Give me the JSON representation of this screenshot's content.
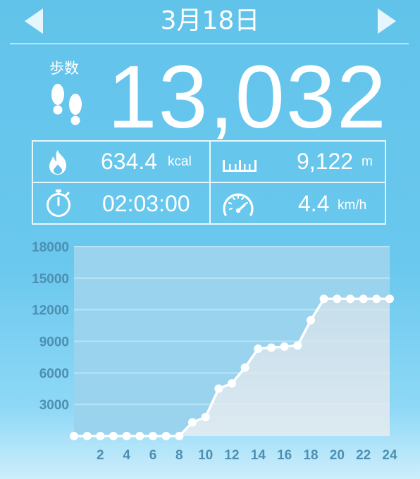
{
  "header": {
    "date": "3月18日",
    "prev_icon": "triangle-left",
    "next_icon": "triangle-right"
  },
  "steps": {
    "label": "歩数",
    "value": "13,032",
    "icon": "footprints"
  },
  "stats": {
    "calories": {
      "value": "634.4",
      "unit": "kcal",
      "icon": "flame"
    },
    "distance": {
      "value": "9,122",
      "unit": "m",
      "icon": "ruler"
    },
    "duration": {
      "value": "02:03:00",
      "unit": "",
      "icon": "stopwatch"
    },
    "speed": {
      "value": "4.4",
      "unit": "km/h",
      "icon": "speedometer"
    }
  },
  "colors": {
    "background": "#62c3ea",
    "line": "#ffffff",
    "plot_area": "#9ad3ee",
    "tick_label": "#4d8fb2"
  },
  "chart_data": {
    "type": "line",
    "x": [
      0,
      1,
      2,
      3,
      4,
      5,
      6,
      7,
      8,
      9,
      10,
      11,
      12,
      13,
      14,
      15,
      16,
      17,
      18,
      19,
      20,
      21,
      22,
      23,
      24
    ],
    "values": [
      0,
      0,
      0,
      0,
      0,
      0,
      0,
      0,
      0,
      1300,
      1800,
      4500,
      5000,
      6500,
      8300,
      8400,
      8500,
      8600,
      11000,
      13032,
      13032,
      13032,
      13032,
      13032,
      13032
    ],
    "xticks": [
      "2",
      "4",
      "6",
      "8",
      "10",
      "12",
      "14",
      "16",
      "18",
      "20",
      "22",
      "24"
    ],
    "yticks": [
      "3000",
      "6000",
      "9000",
      "12000",
      "15000",
      "18000"
    ],
    "xlim": [
      0,
      24
    ],
    "ylim": [
      0,
      18000
    ],
    "grid": true,
    "cumulative": true
  }
}
